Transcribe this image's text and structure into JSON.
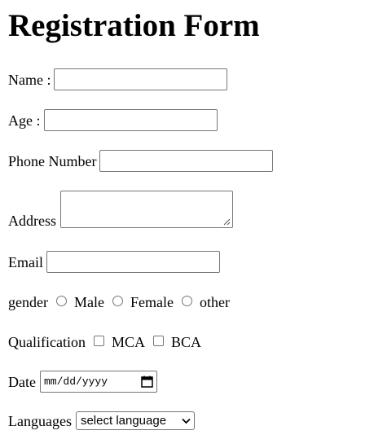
{
  "form": {
    "title": "Registration Form",
    "name": {
      "label": "Name :",
      "value": ""
    },
    "age": {
      "label": "Age :",
      "value": ""
    },
    "phone": {
      "label": "Phone Number",
      "value": ""
    },
    "address": {
      "label": "Address",
      "value": ""
    },
    "email": {
      "label": "Email",
      "value": ""
    },
    "gender": {
      "label": "gender",
      "options": [
        "Male",
        "Female",
        "other"
      ]
    },
    "qualification": {
      "label": "Qualification",
      "options": [
        "MCA",
        "BCA"
      ]
    },
    "date": {
      "label": "Date",
      "placeholder": "mm/dd/yyyy"
    },
    "languages": {
      "label": "Languages",
      "selected": "select language"
    }
  },
  "icons": {
    "date_picker": "calendar-icon",
    "select_arrow": "chevron-down-icon",
    "textarea_resize": "resize-grip-icon"
  }
}
